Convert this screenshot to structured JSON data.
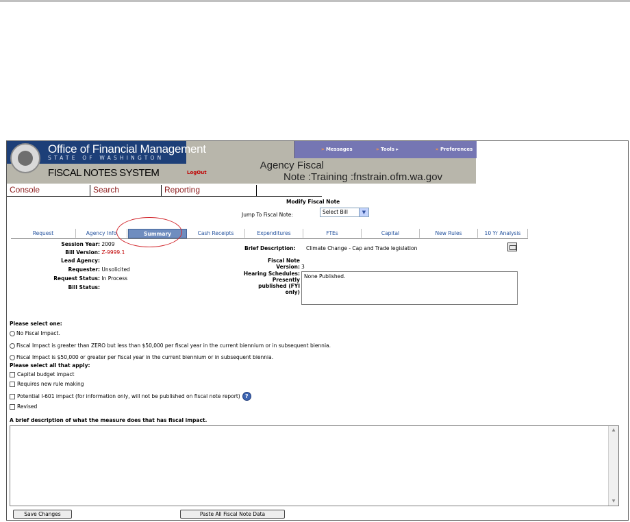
{
  "header": {
    "org_title": "Office of Financial Management",
    "org_subtitle": "STATE OF WASHINGTON",
    "system_title": "FISCAL NOTES SYSTEM",
    "logout": "LogOut",
    "topnav": {
      "messages": "Messages",
      "tools": "Tools",
      "preferences": "Preferences"
    },
    "agency_line1": "Agency Fiscal",
    "agency_line2": "Note :Training :fnstrain.ofm.wa.gov"
  },
  "menu": {
    "console": "Console",
    "search": "Search",
    "reporting": "Reporting"
  },
  "form": {
    "title": "Modify Fiscal Note",
    "jump_label": "Jump To Fiscal Note:",
    "jump_value": "Select Bill"
  },
  "tabs": [
    "Request",
    "Agency Info",
    "Summary",
    "Cash Receipts",
    "Expenditures",
    "FTEs",
    "Capital",
    "New Rules",
    "10 Yr Analysis"
  ],
  "details": {
    "session_year_label": "Session Year:",
    "session_year": "2009",
    "bill_version_label": "Bill Version:",
    "bill_version": "Z-9999.1",
    "lead_agency_label": "Lead Agency:",
    "lead_agency": "",
    "requester_label": "Requester:",
    "requester": "Unsolicited",
    "request_status_label": "Request Status:",
    "request_status": "In Process",
    "bill_status_label": "Bill Status:",
    "bill_status": "",
    "brief_label": "Brief Description:",
    "brief": "Climate Change - Cap and Trade legislation",
    "fn_version_label_1": "Fiscal Note",
    "fn_version_label_2": "Version:",
    "fn_version": "3",
    "hs_label_1": "Hearing Schedules:",
    "hs_label_2": "Presently",
    "hs_label_3": "published (FYI",
    "hs_label_4": "only)",
    "hs_value": "None Published."
  },
  "impact": {
    "select_one": "Please select one:",
    "radios": [
      "No Fiscal Impact.",
      "Fiscal Impact is greater than ZERO but less than $50,000 per fiscal year in the current biennium or in subsequent biennia.",
      "Fiscal Impact is $50,000 or greater per fiscal year in the current biennium or in subsequent biennia."
    ],
    "select_all": "Please select all that apply:",
    "checks": [
      "Capital budget impact",
      "Requires new rule making",
      "Potential I-601 impact (for information only, will not be published on fiscal note report)",
      "Revised"
    ],
    "desc_label": "A brief description of what the measure does that has fiscal impact."
  },
  "buttons": {
    "save": "Save Changes",
    "paste": "Paste All Fiscal Note Data"
  }
}
